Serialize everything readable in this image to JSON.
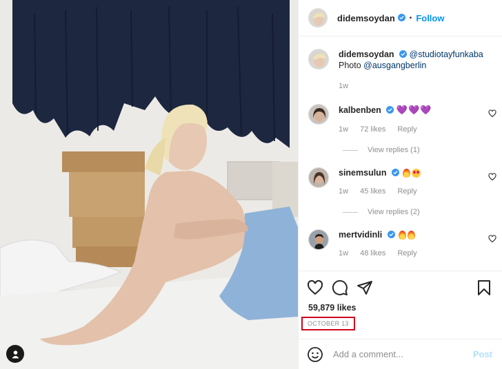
{
  "post": {
    "author": "didemsoydan",
    "follow_label": "Follow",
    "dot": "•"
  },
  "caption": {
    "username": "didemsoydan",
    "mention": "@studiotayfunkaba",
    "photo_label": "Photo",
    "photo_mention": "@ausgangberlin",
    "time": "1w"
  },
  "comments": [
    {
      "username": "kalbenben",
      "text_emoji": "💜💜💜",
      "time": "1w",
      "likes": "72 likes",
      "reply": "Reply",
      "view_replies": "View replies (1)"
    },
    {
      "username": "sinemsulun",
      "time": "1w",
      "likes": "45 likes",
      "reply": "Reply",
      "view_replies": "View replies (2)"
    },
    {
      "username": "mertvidinli",
      "time": "1w",
      "likes": "48 likes",
      "reply": "Reply"
    }
  ],
  "actions": {
    "likes": "59,879 likes",
    "date": "OCTOBER 13"
  },
  "add_comment": {
    "placeholder": "Add a comment...",
    "post_label": "Post"
  },
  "colors": {
    "accent": "#0095f6",
    "verified": "#3897f0",
    "date_highlight": "#d0021b"
  },
  "icons": [
    "user-tag-icon",
    "verified-icon",
    "heart-icon",
    "comment-icon",
    "share-icon",
    "save-icon",
    "emoji-icon"
  ]
}
